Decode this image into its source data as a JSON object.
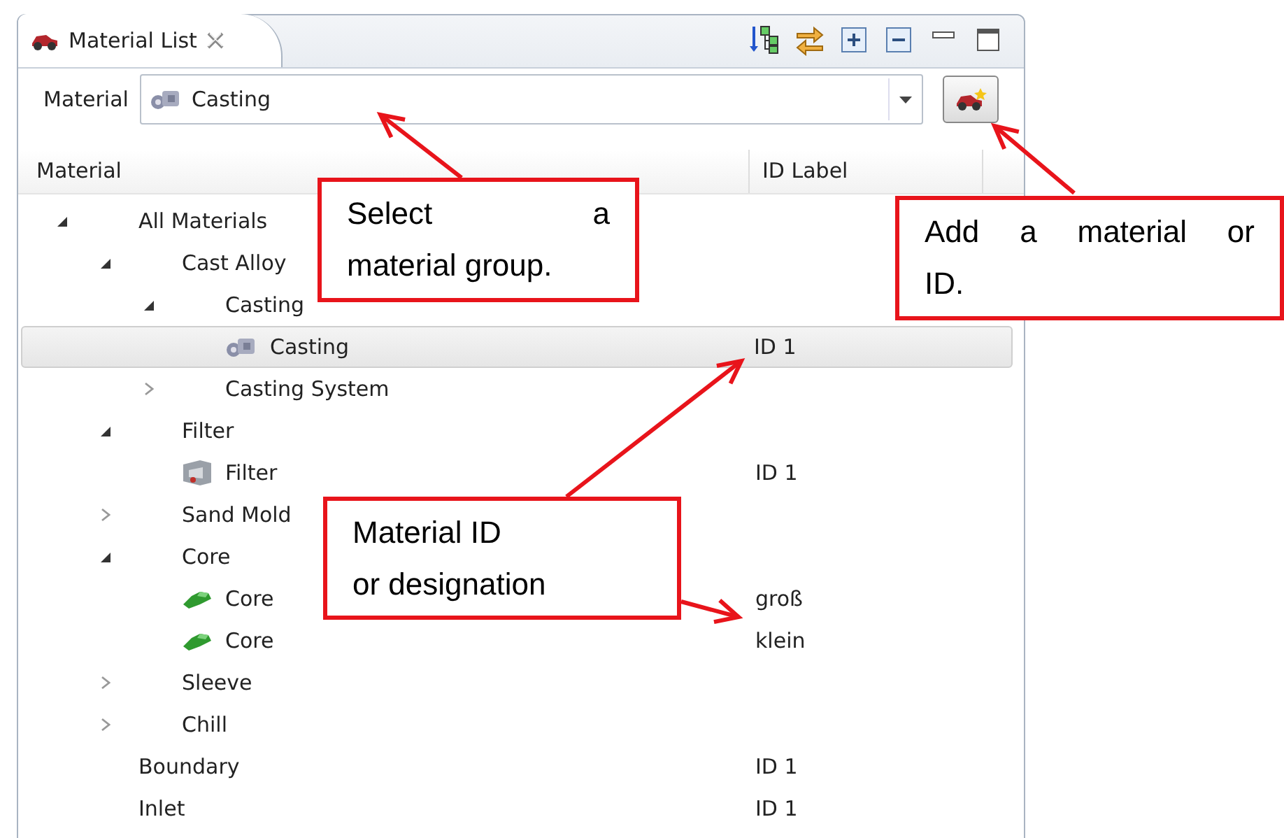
{
  "view": {
    "title": "Material List"
  },
  "material_selector": {
    "label": "Material",
    "value": "Casting"
  },
  "columns": [
    "Material",
    "ID Label"
  ],
  "tree": [
    {
      "label": "All Materials",
      "expanded": true,
      "selected": false,
      "children": [
        {
          "label": "Cast Alloy",
          "expanded": true,
          "selected": false,
          "children": [
            {
              "label": "Casting",
              "expanded": true,
              "selected": false,
              "children": [
                {
                  "label": "Casting",
                  "kind": "casting",
                  "id_label": "ID 1",
                  "selected": true
                }
              ]
            },
            {
              "label": "Casting System",
              "expanded": false,
              "selected": false
            }
          ]
        },
        {
          "label": "Filter",
          "expanded": true,
          "selected": false,
          "children": [
            {
              "label": "Filter",
              "kind": "filter",
              "id_label": "ID 1",
              "selected": false
            }
          ]
        },
        {
          "label": "Sand Mold",
          "expanded": false,
          "selected": false
        },
        {
          "label": "Core",
          "expanded": true,
          "selected": false,
          "children": [
            {
              "label": "Core",
              "kind": "core",
              "id_label": "groß",
              "selected": false
            },
            {
              "label": "Core",
              "kind": "core",
              "id_label": "klein",
              "selected": false
            }
          ]
        },
        {
          "label": "Sleeve",
          "expanded": false,
          "selected": false
        },
        {
          "label": "Chill",
          "expanded": false,
          "selected": false
        }
      ]
    },
    {
      "label": "Boundary",
      "id_label": "ID 1",
      "selected": false
    },
    {
      "label": "Inlet",
      "id_label": "ID 1",
      "selected": false
    }
  ],
  "callouts": [
    {
      "lines": [
        "Select a",
        "material group."
      ],
      "justified": true
    },
    {
      "lines": [
        "Add a material or",
        "ID."
      ],
      "justified": true
    },
    {
      "lines": [
        "Material ID",
        "or designation"
      ],
      "justified": false
    }
  ]
}
